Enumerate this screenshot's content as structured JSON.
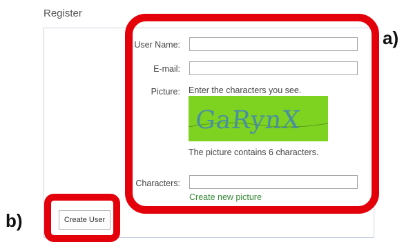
{
  "page": {
    "title": "Register"
  },
  "form": {
    "username_label": "User Name:",
    "username_value": "",
    "email_label": "E-mail:",
    "email_value": "",
    "picture_label": "Picture:",
    "captcha_instruction": "Enter the characters you see.",
    "captcha_text": "GaRynX",
    "captcha_note": "The picture contains 6 characters.",
    "characters_label": "Characters:",
    "characters_value": "",
    "new_picture_link": "Create new picture",
    "submit_label": "Create User"
  },
  "annotations": {
    "a": "a)",
    "b": "b)"
  },
  "colors": {
    "highlight": "#e3000b",
    "captcha_bg": "#7ed321",
    "link": "#3a8a3a"
  }
}
